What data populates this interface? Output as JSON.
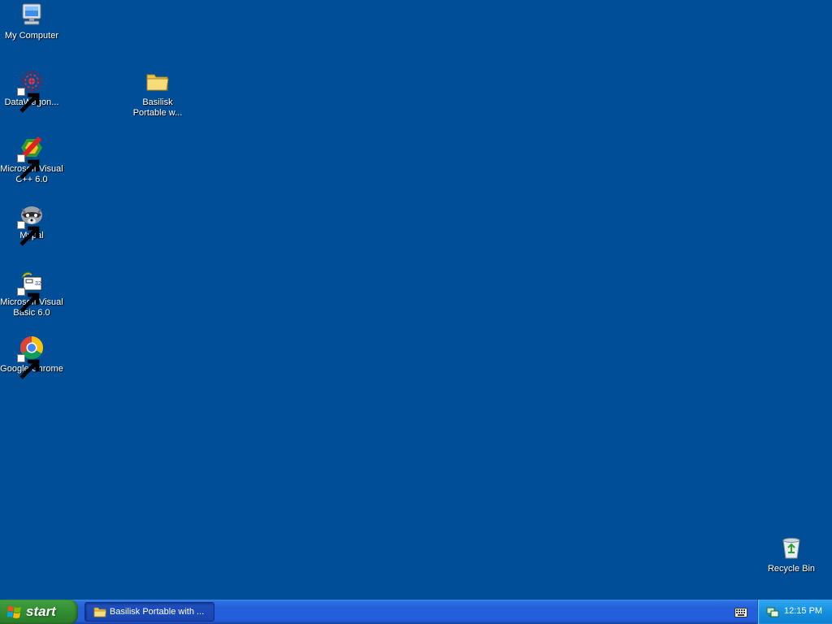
{
  "desktop": {
    "background_color": "#004e98",
    "icons": [
      {
        "name": "my-computer",
        "label": "My Computer",
        "icon": "computer-icon",
        "shortcut": false
      },
      {
        "name": "datawagon",
        "label": "DataWagon...",
        "icon": "datawagon-icon",
        "shortcut": true
      },
      {
        "name": "basilisk",
        "label": "Basilisk Portable w...",
        "icon": "folder-icon",
        "shortcut": false
      },
      {
        "name": "visual-cpp",
        "label": "Microsoft Visual C++ 6.0",
        "icon": "visual-cpp-icon",
        "shortcut": true
      },
      {
        "name": "mypal",
        "label": "Mypal",
        "icon": "raccoon-icon",
        "shortcut": true
      },
      {
        "name": "visual-basic",
        "label": "Microsoft Visual Basic 6.0",
        "icon": "visual-basic-icon",
        "shortcut": true
      },
      {
        "name": "google-chrome",
        "label": "Google Chrome",
        "icon": "chrome-icon",
        "shortcut": true
      },
      {
        "name": "recycle-bin",
        "label": "Recycle Bin",
        "icon": "recycle-bin-icon",
        "shortcut": false
      }
    ]
  },
  "taskbar": {
    "start_label": "start",
    "task_button_label": "Basilisk Portable with ...",
    "task_button_icon": "folder-icon",
    "clock": "12:15 PM",
    "tray_icons": [
      "keyboard-icon",
      "network-icon"
    ],
    "colors": {
      "taskbar": "#245edb",
      "start_button": "#3c9a3c",
      "tray": "#0f8fe0"
    }
  }
}
